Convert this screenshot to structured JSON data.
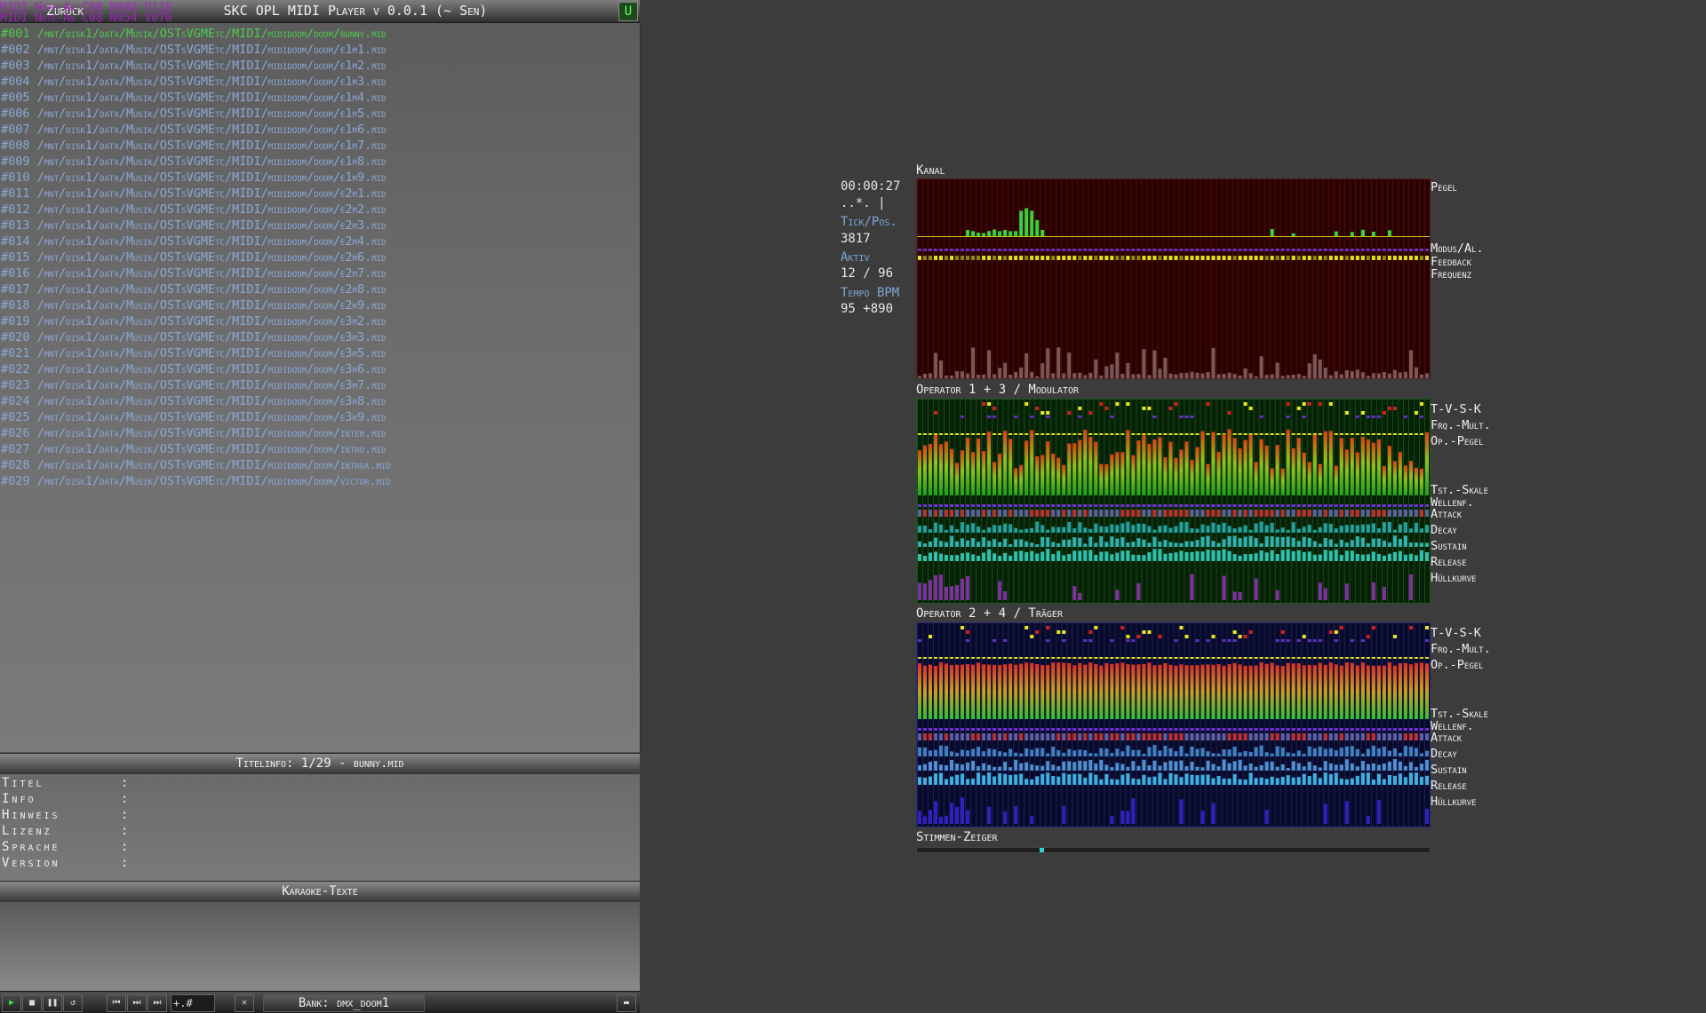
{
  "window": {
    "back_label": "Zurück",
    "title": "SKC OPL MIDI Player v 0.0.1 (~ Sen)",
    "u_label": "U"
  },
  "ghost_lines": [
    "MIDI Note-An  C00 N040 V110",
    "MIDI Note-An  C08 N054 V070"
  ],
  "playlist": [
    "#001 /mnt/disk1/data/Musik/OSTsVGMEtc/MIDI/mididoom/doom/bunny.mid",
    "#002 /mnt/disk1/data/Musik/OSTsVGMEtc/MIDI/mididoom/doom/e1m1.mid",
    "#003 /mnt/disk1/data/Musik/OSTsVGMEtc/MIDI/mididoom/doom/e1m2.mid",
    "#004 /mnt/disk1/data/Musik/OSTsVGMEtc/MIDI/mididoom/doom/e1m3.mid",
    "#005 /mnt/disk1/data/Musik/OSTsVGMEtc/MIDI/mididoom/doom/e1m4.mid",
    "#006 /mnt/disk1/data/Musik/OSTsVGMEtc/MIDI/mididoom/doom/e1m5.mid",
    "#007 /mnt/disk1/data/Musik/OSTsVGMEtc/MIDI/mididoom/doom/e1m6.mid",
    "#008 /mnt/disk1/data/Musik/OSTsVGMEtc/MIDI/mididoom/doom/e1m7.mid",
    "#009 /mnt/disk1/data/Musik/OSTsVGMEtc/MIDI/mididoom/doom/e1m8.mid",
    "#010 /mnt/disk1/data/Musik/OSTsVGMEtc/MIDI/mididoom/doom/e1m9.mid",
    "#011 /mnt/disk1/data/Musik/OSTsVGMEtc/MIDI/mididoom/doom/e2m1.mid",
    "#012 /mnt/disk1/data/Musik/OSTsVGMEtc/MIDI/mididoom/doom/e2m2.mid",
    "#013 /mnt/disk1/data/Musik/OSTsVGMEtc/MIDI/mididoom/doom/e2m3.mid",
    "#014 /mnt/disk1/data/Musik/OSTsVGMEtc/MIDI/mididoom/doom/e2m4.mid",
    "#015 /mnt/disk1/data/Musik/OSTsVGMEtc/MIDI/mididoom/doom/e2m6.mid",
    "#016 /mnt/disk1/data/Musik/OSTsVGMEtc/MIDI/mididoom/doom/e2m7.mid",
    "#017 /mnt/disk1/data/Musik/OSTsVGMEtc/MIDI/mididoom/doom/e2m8.mid",
    "#018 /mnt/disk1/data/Musik/OSTsVGMEtc/MIDI/mididoom/doom/e2m9.mid",
    "#019 /mnt/disk1/data/Musik/OSTsVGMEtc/MIDI/mididoom/doom/e3m2.mid",
    "#020 /mnt/disk1/data/Musik/OSTsVGMEtc/MIDI/mididoom/doom/e3m3.mid",
    "#021 /mnt/disk1/data/Musik/OSTsVGMEtc/MIDI/mididoom/doom/e3m5.mid",
    "#022 /mnt/disk1/data/Musik/OSTsVGMEtc/MIDI/mididoom/doom/e3m6.mid",
    "#023 /mnt/disk1/data/Musik/OSTsVGMEtc/MIDI/mididoom/doom/e3m7.mid",
    "#024 /mnt/disk1/data/Musik/OSTsVGMEtc/MIDI/mididoom/doom/e3m8.mid",
    "#025 /mnt/disk1/data/Musik/OSTsVGMEtc/MIDI/mididoom/doom/e3m9.mid",
    "#026 /mnt/disk1/data/Musik/OSTsVGMEtc/MIDI/mididoom/doom/inter.mid",
    "#027 /mnt/disk1/data/Musik/OSTsVGMEtc/MIDI/mididoom/doom/intro.mid",
    "#028 /mnt/disk1/data/Musik/OSTsVGMEtc/MIDI/mididoom/doom/introa.mid",
    "#029 /mnt/disk1/data/Musik/OSTsVGMEtc/MIDI/mididoom/doom/victor.mid"
  ],
  "titleinfo": {
    "header": "Titelinfo: 1/29 - bunny.mid",
    "fields": [
      {
        "label": "Titel",
        "colon": ":"
      },
      {
        "label": "Info",
        "colon": ":"
      },
      {
        "label": "Hinweis",
        "colon": ":"
      },
      {
        "label": "Lizenz",
        "colon": ":"
      },
      {
        "label": "Sprache",
        "colon": ":"
      },
      {
        "label": "Version",
        "colon": ":"
      }
    ]
  },
  "karaoke": {
    "header": "Karaoke-Texte"
  },
  "toolbar": {
    "seek_value": "+.#",
    "bank_label": "Bank: dmx_doom1",
    "close_symbol": "✕"
  },
  "status": {
    "time": "00:00:27",
    "time_sub": "..*. |",
    "tick_label": "Tick/Pos.",
    "tick_value": "3817",
    "aktiv_label": "Aktiv",
    "aktiv_value": "12 / 96",
    "tempo_label": "Tempo BPM",
    "tempo_value": "95 +890"
  },
  "visualizer": {
    "kanal_title": "Kanal",
    "kanal_labels": [
      "Pegel",
      "Modus/Al.",
      "Feedback",
      "Frequenz"
    ],
    "op1_title": "Operator 1 + 3 / Modulator",
    "op2_title": "Operator 2 + 4 / Träger",
    "op_labels": [
      "T-V-S-K",
      "Frq.-Mult.",
      "Op.-Pegel",
      "Tst.-Skale",
      "Wellenf.",
      "Attack",
      "Decay",
      "Sustain",
      "Release",
      "Hüllkurve"
    ],
    "stimmen_title": "Stimmen-Zeiger",
    "colors": {
      "kanal_bg": "#2a0000",
      "op1_bg": "#062206",
      "op2_bg": "#080a2c",
      "accent_green": "#4ecb4e",
      "accent_yellow": "#f0f020"
    }
  }
}
